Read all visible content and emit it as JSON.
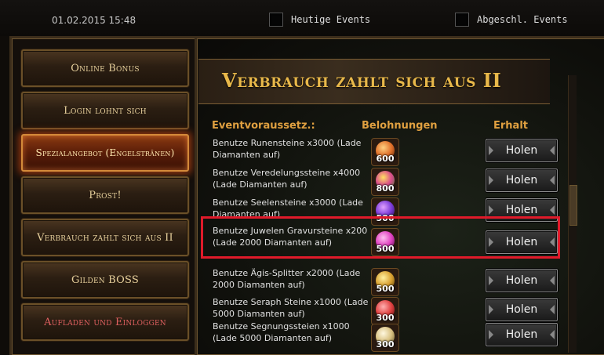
{
  "header": {
    "datetime": "01.02.2015 15:48",
    "today_events": "Heutige Events",
    "completed_events": "Abgeschl. Events"
  },
  "sidebar": {
    "items": [
      {
        "label": "Online Bonus"
      },
      {
        "label": "Login lohnt sich"
      },
      {
        "label": "Spezialangebot (Engelstränen)"
      },
      {
        "label": "Prost!"
      },
      {
        "label": "Verbrauch zahlt sich aus II"
      },
      {
        "label": "Gilden BOSS"
      },
      {
        "label": "Aufladen und Einloggen"
      }
    ]
  },
  "main": {
    "title": "Verbrauch zahlt sich aus II",
    "columns": {
      "condition": "Eventvoraussetz.:",
      "reward": "Belohnungen",
      "claim": "Erhalt"
    },
    "rows": [
      {
        "condition": "Benutze Runensteine x3000 (Lade Diamanten auf)",
        "reward_qty": "600",
        "claim_label": "Holen",
        "gem_color": "#e0702a"
      },
      {
        "condition": "Benutze Veredelungssteine x4000 (Lade Diamanten auf)",
        "reward_qty": "800",
        "claim_label": "Holen",
        "gem_color": "#d84a8a"
      },
      {
        "condition": "Benutze Seelensteine x3000 (Lade Diamanten auf)",
        "reward_qty": "500",
        "claim_label": "Holen",
        "gem_color": "#7a3ad8"
      },
      {
        "condition": "Benutze Juwelen Gravursteine x200 (Lade 2000 Diamanten auf)",
        "reward_qty": "500",
        "claim_label": "Holen",
        "gem_color": "#e040c0"
      },
      {
        "condition": "Benutze Ägis-Splitter x2000 (Lade 2000 Diamanten auf)",
        "reward_qty": "500",
        "claim_label": "Holen",
        "gem_color": "#d8a030"
      },
      {
        "condition": "Benutze Seraph Steine x1000 (Lade 5000 Diamanten auf)",
        "reward_qty": "300",
        "claim_label": "Holen",
        "gem_color": "#e04040"
      },
      {
        "condition": "Benutze Segnungssteien x1000 (Lade 5000 Diamanten auf)",
        "reward_qty": "300",
        "claim_label": "Holen",
        "gem_color": "#d8c080"
      }
    ]
  }
}
